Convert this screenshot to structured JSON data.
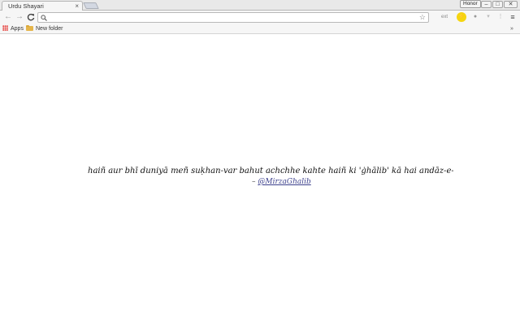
{
  "browser": {
    "tab": {
      "title": "Urdu Shayari",
      "close": "×"
    },
    "user_badge": "Honor",
    "window_buttons": {
      "minimize": "–",
      "maximize": "□",
      "close": "✕"
    },
    "toolbar": {
      "back": "←",
      "forward": "→",
      "reload": "C",
      "omnibox_value": "",
      "star": "☆",
      "extensions": [
        "ext",
        "⚡",
        "●",
        "▾",
        "⋮",
        "≡"
      ]
    },
    "bookmarks": {
      "items": [
        "Apps",
        "New folder"
      ],
      "more": "»"
    }
  },
  "page": {
    "verse": "haiñ aur bhī duniyā meñ suḳhan-var bahut achchhe kahte haiñ ki 'ġhālib' kā hai andāz-e-bayāñ aur",
    "attribution_prefix": "– ",
    "author": "@MirzaGhalib"
  },
  "colors": {
    "tab_bg": "#f6f6f6",
    "toolbar_bg": "#f6f6f6",
    "link": "#3b3f8c",
    "ext_accent": "#f5d50f"
  }
}
